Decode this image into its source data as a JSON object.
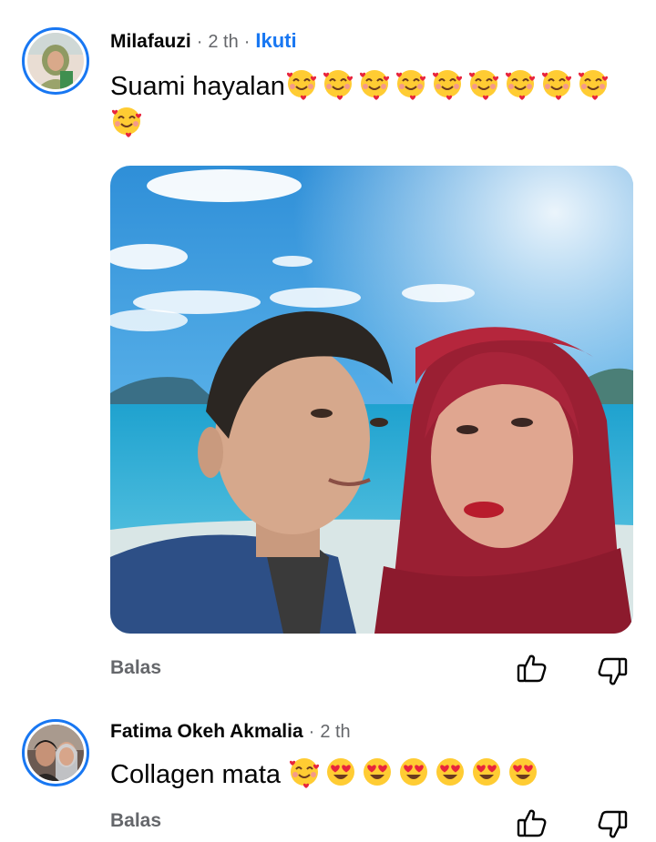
{
  "comments": [
    {
      "author": "Milafauzi",
      "separator": "·",
      "time": "2 th",
      "separator2": "·",
      "follow_label": "Ikuti",
      "text": "Suami hayalan",
      "emoji": [
        "smiling-face-with-hearts",
        "smiling-face-with-hearts",
        "smiling-face-with-hearts",
        "smiling-face-with-hearts",
        "smiling-face-with-hearts",
        "smiling-face-with-hearts",
        "smiling-face-with-hearts",
        "smiling-face-with-hearts",
        "smiling-face-with-hearts",
        "smiling-face-with-hearts"
      ],
      "has_photo": true,
      "reply_label": "Balas"
    },
    {
      "author": "Fatima Okeh Akmalia",
      "separator": "·",
      "time": "2 th",
      "text": "Collagen mata",
      "emoji": [
        "smiling-face-with-hearts",
        "heart-eyes",
        "heart-eyes",
        "heart-eyes",
        "heart-eyes",
        "heart-eyes",
        "heart-eyes"
      ],
      "reply_label": "Balas"
    }
  ],
  "icons": {
    "like": "thumbs-up-icon",
    "dislike": "thumbs-down-icon"
  },
  "colors": {
    "accent": "#1877f2",
    "muted": "#65676b",
    "text": "#050505"
  }
}
